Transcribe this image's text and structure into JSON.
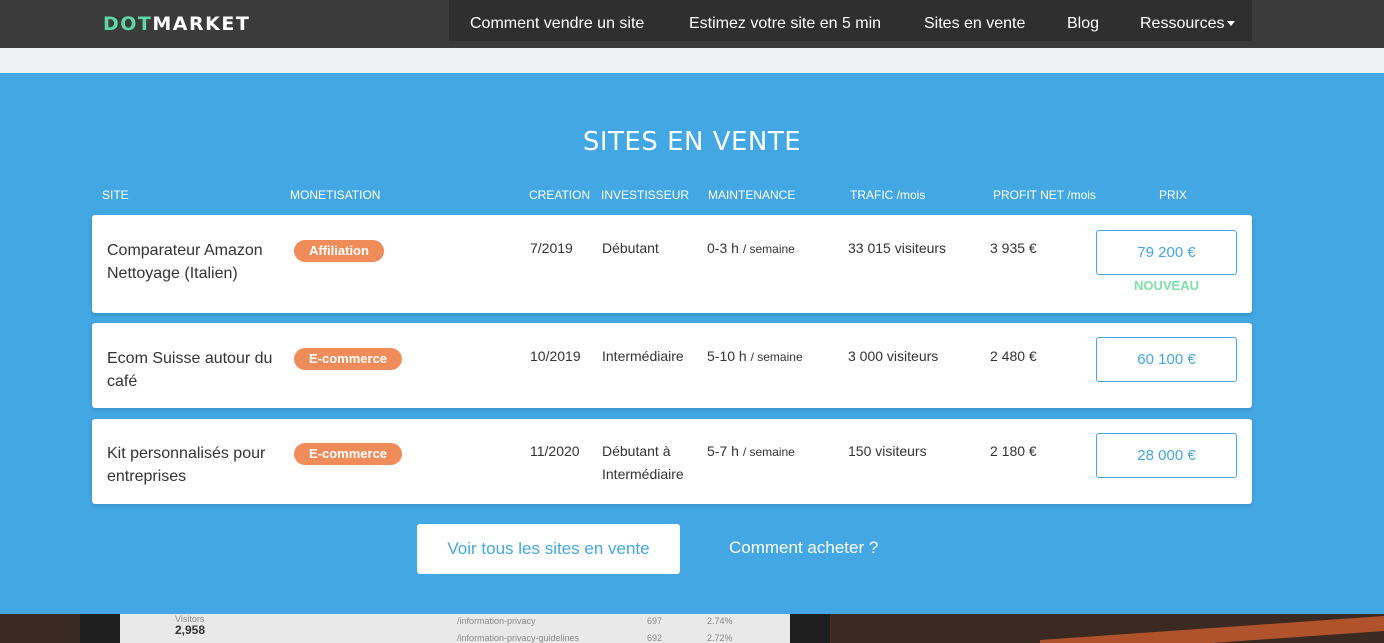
{
  "brand": {
    "part1": "DOT",
    "part2": "MARKET"
  },
  "nav": {
    "items": [
      {
        "label": "Comment vendre un site"
      },
      {
        "label": "Estimez votre site en 5 min"
      },
      {
        "label": "Sites en vente"
      },
      {
        "label": "Blog"
      },
      {
        "label": "Ressources"
      }
    ]
  },
  "section": {
    "title": "SITES EN VENTE",
    "columns": [
      "SITE",
      "MONETISATION",
      "CREATION",
      "INVESTISSEUR",
      "MAINTENANCE",
      "TRAFIC /mois",
      "PROFIT NET /mois",
      "PRIX"
    ],
    "listings": [
      {
        "site": "Comparateur Amazon Nettoyage (Italien)",
        "monetisation": "Affiliation",
        "creation": "7/2019",
        "investisseur": "Débutant",
        "maintenance": "0-3 h",
        "maintenance_unit": "/ semaine",
        "trafic": "33 015 visiteurs",
        "profit": "3 935 €",
        "prix": "79 200 €",
        "tag": "NOUVEAU"
      },
      {
        "site": "Ecom Suisse autour du café",
        "monetisation": "E-commerce",
        "creation": "10/2019",
        "investisseur": "Intermédiaire",
        "maintenance": "5-10 h",
        "maintenance_unit": "/ semaine",
        "trafic": "3 000 visiteurs",
        "profit": "2 480 €",
        "prix": "60 100 €"
      },
      {
        "site": "Kit personnalisés pour entreprises",
        "monetisation": "E-commerce",
        "creation": "11/2020",
        "investisseur": "Débutant à Intermédiaire",
        "maintenance": "5-7 h",
        "maintenance_unit": "/ semaine",
        "trafic": "150 visiteurs",
        "profit": "2 180 €",
        "prix": "28 000 €"
      }
    ],
    "see_all_button": "Voir tous les sites en vente",
    "how_to_buy_link": "Comment acheter ?"
  },
  "background": {
    "visitors_label": "Visitors",
    "visitors_value": "2,958",
    "rows": [
      {
        "path": "/information-privacy",
        "count": "697",
        "pct": "2.74%"
      },
      {
        "path": "/information-privacy-guidelines",
        "count": "692",
        "pct": "2.72%"
      }
    ]
  },
  "colors": {
    "topbar": "#3b3b3b",
    "brand_accent": "#5ed6a6",
    "section_bg": "#43a7e4",
    "badge": "#f08c5a",
    "new_tag": "#7ee0a8"
  }
}
